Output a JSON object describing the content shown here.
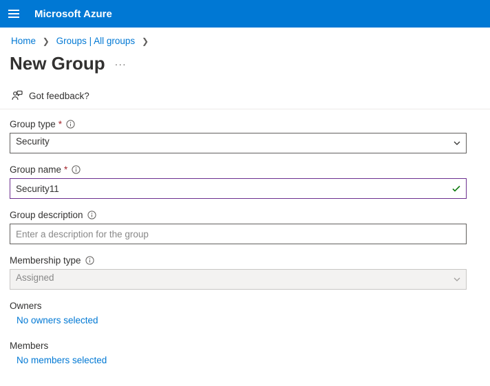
{
  "topbar": {
    "brand": "Microsoft Azure"
  },
  "breadcrumb": {
    "home": "Home",
    "groups": "Groups | All groups"
  },
  "page": {
    "title": "New Group"
  },
  "feedback": {
    "label": "Got feedback?"
  },
  "form": {
    "group_type": {
      "label": "Group type",
      "value": "Security"
    },
    "group_name": {
      "label": "Group name",
      "value": "Security11"
    },
    "group_description": {
      "label": "Group description",
      "placeholder": "Enter a description for the group",
      "value": ""
    },
    "membership_type": {
      "label": "Membership type",
      "value": "Assigned"
    },
    "owners": {
      "heading": "Owners",
      "none_link": "No owners selected"
    },
    "members": {
      "heading": "Members",
      "none_link": "No members selected"
    }
  }
}
